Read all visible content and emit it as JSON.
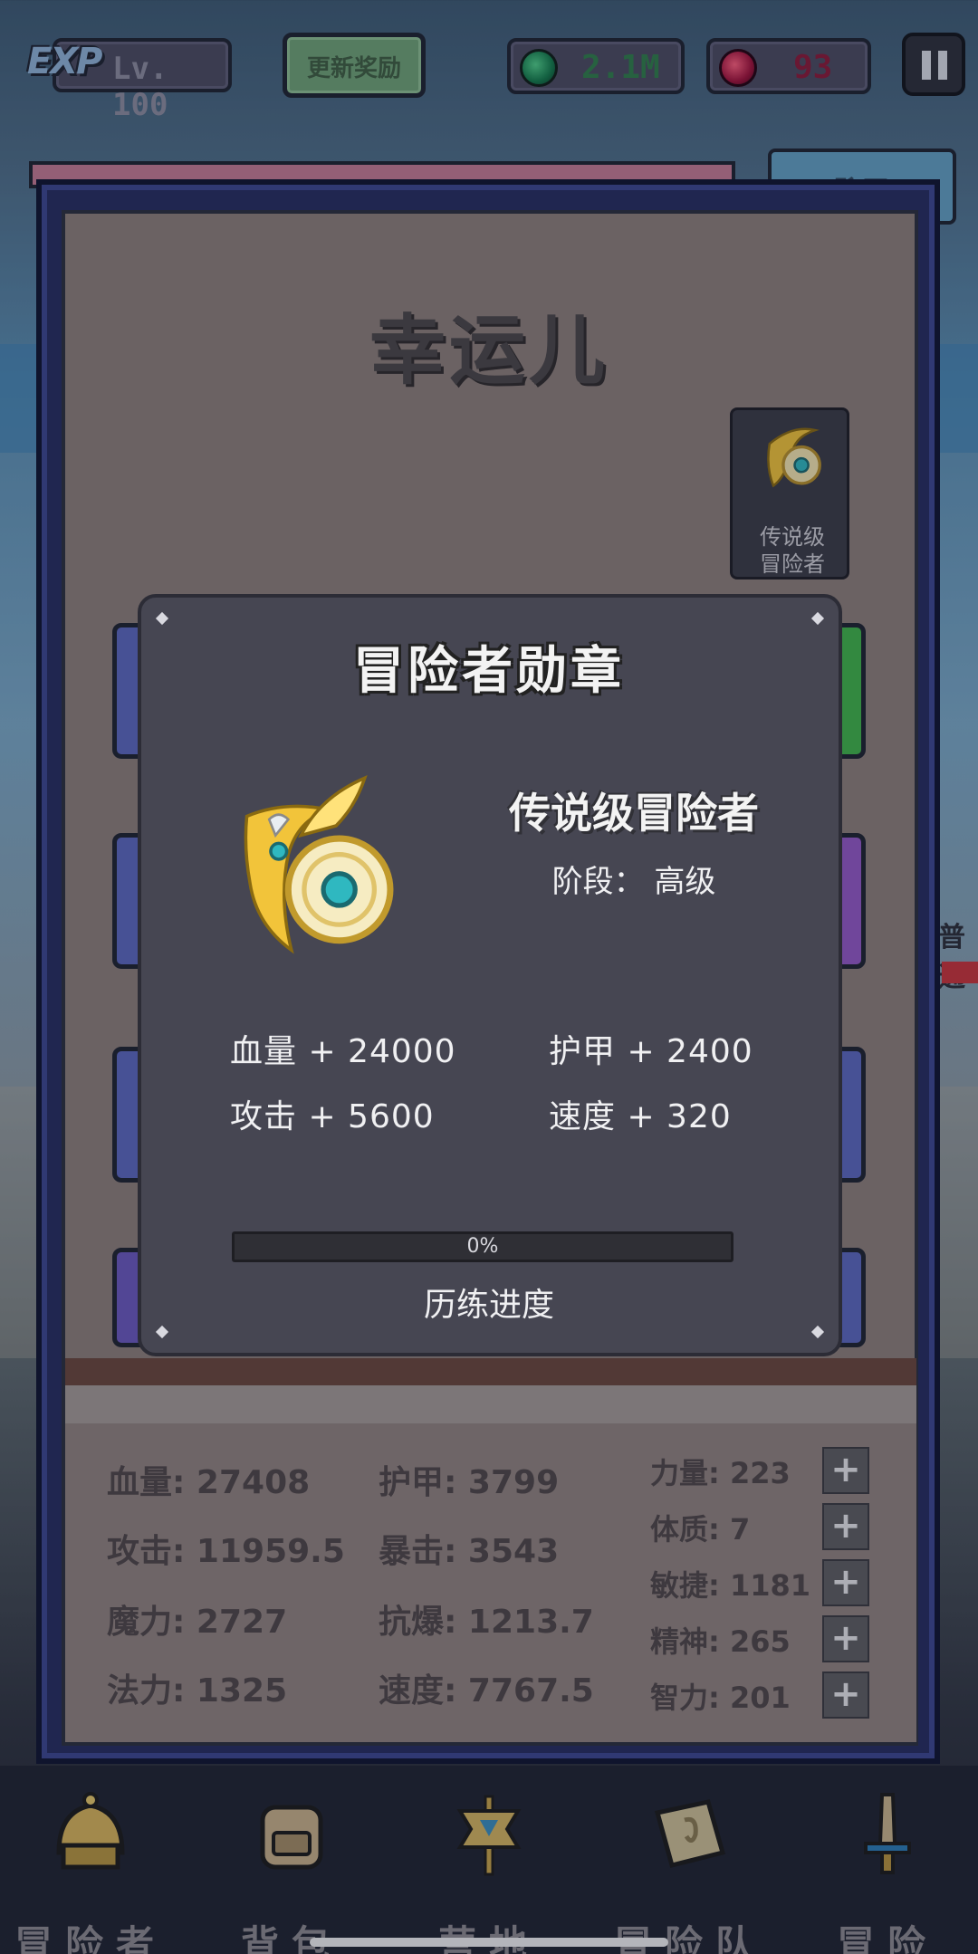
{
  "top_bar": {
    "exp_logo": "EXP",
    "level": "Lv. 100",
    "reward_label": "更新奖励",
    "gems": "2.1M",
    "rubies": "93"
  },
  "background": {
    "peek_button": "聊天",
    "peek_text": "普通"
  },
  "character": {
    "name": "幸运儿",
    "badge_label_line1": "传说级",
    "badge_label_line2": "冒险者"
  },
  "modal": {
    "title": "冒险者勋章",
    "medal_name": "传说级冒险者",
    "stage": "阶段： 高级",
    "attributes": [
      {
        "label": "血量 + 24000"
      },
      {
        "label": "护甲 + 2400"
      },
      {
        "label": "攻击 + 5600"
      },
      {
        "label": "速度 + 320"
      }
    ],
    "progress_value": 0,
    "progress_text": "0%",
    "progress_label": "历练进度"
  },
  "stats": {
    "left": [
      "血量: 27408",
      "攻击: 11959.5",
      "魔力: 2727",
      "法力: 1325"
    ],
    "middle": [
      "护甲: 3799",
      "暴击: 3543",
      "抗爆: 1213.7",
      "速度: 7767.5"
    ],
    "right": [
      "力量: 223",
      "体质: 7",
      "敏捷: 1181",
      "精神: 265",
      "智力: 201"
    ],
    "plus_symbol": "+"
  },
  "nav": [
    {
      "label": "冒险者",
      "icon": "helmet-icon"
    },
    {
      "label": "背包",
      "icon": "backpack-icon"
    },
    {
      "label": "营地",
      "icon": "camp-banner-icon"
    },
    {
      "label": "冒险队",
      "icon": "book-icon"
    },
    {
      "label": "冒险",
      "icon": "sword-icon"
    }
  ],
  "colors": {
    "panel_bg": "#8c7e7a",
    "modal_bg": "#464652",
    "frame": "#242c60",
    "gold": "#f2c43a"
  }
}
